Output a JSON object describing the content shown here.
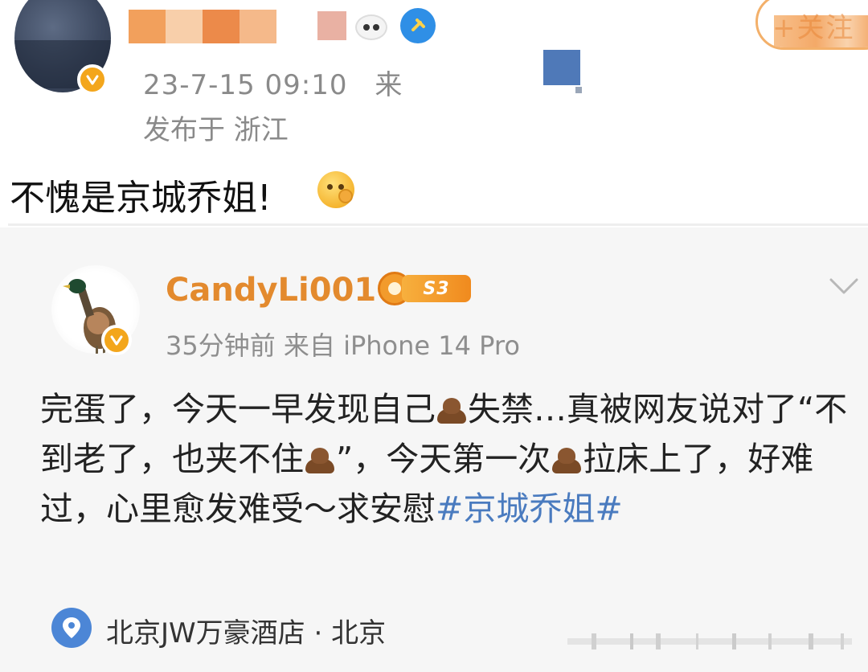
{
  "post": {
    "time": "23-7-15 09:10",
    "source_prefix": "来",
    "location": "发布于 浙江",
    "follow_label": "+关注",
    "comment": "不愧是京城乔姐!"
  },
  "quoted": {
    "username": "CandyLi001",
    "level": "S3",
    "meta": "35分钟前  来自 iPhone 14 Pro",
    "body": {
      "part1": "完蛋了，今天一早发现自己",
      "part2": "失禁…真被网友说对了“不到老了，也夹不住",
      "part3": "”，今天第一次",
      "part4": "拉床上了，好难过，心里愈发难受～求安慰",
      "hashtag": "#京城乔姐#"
    },
    "checkin": "北京JW万豪酒店 · 北京"
  },
  "colors": {
    "accent_orange": "#e38a2e",
    "link_blue": "#4a7bbf",
    "verified_gold": "#f3a61c",
    "meta_gray": "#8a8a8a"
  },
  "icons": [
    "verified-badge-icon",
    "shield-icon",
    "panda-icon",
    "chevron-down-icon",
    "location-pin-icon",
    "poop-emoji-icon",
    "thinking-emoji-icon"
  ]
}
